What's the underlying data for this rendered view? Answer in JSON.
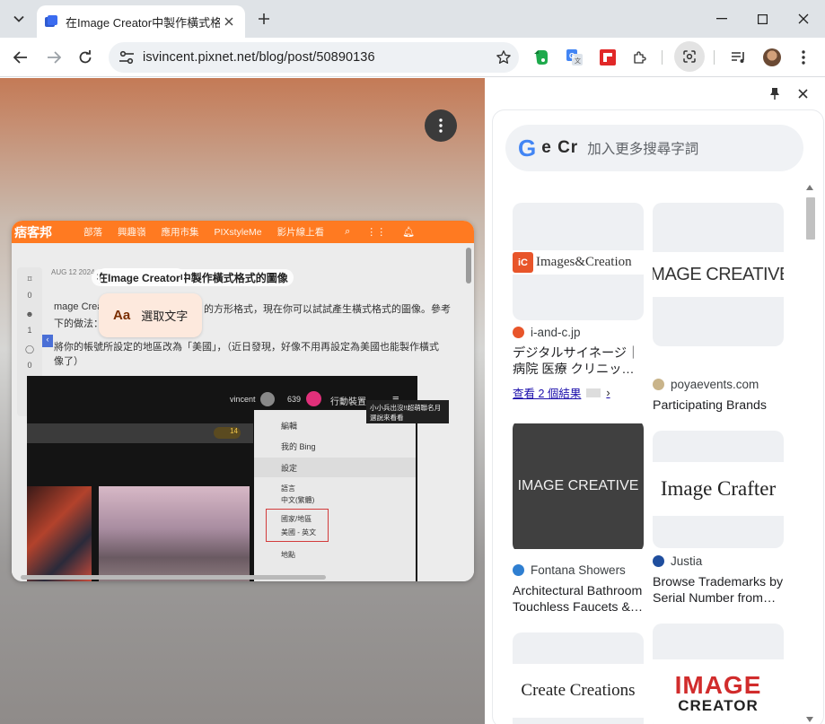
{
  "browser": {
    "tab": {
      "title": "在Image Creator中製作橫式格",
      "favicon": "blue-doc-icon"
    },
    "new_tab_icon": "plus-icon",
    "window_controls": [
      "minimize-icon",
      "maximize-icon",
      "close-icon"
    ],
    "address": {
      "url": "isvincent.pixnet.net/blog/post/50890136"
    },
    "extensions": [
      "evernote-icon",
      "google-translate-icon",
      "flipboard-icon",
      "puzzle-icon",
      "google-lens-icon",
      "media-queue-icon"
    ]
  },
  "lens_view": {
    "select_text_label": "選取文字",
    "select_text_icon": "Aa",
    "screenshot": {
      "logo": "痞客邦",
      "nav": [
        "部落",
        "興趣嶺",
        "應用市集",
        "PIXstyleMe",
        "影片線上看"
      ],
      "date": "AUG 12 2024",
      "title": "在Image Creator中製作橫式格式的圖像",
      "line1": "mage Creat",
      "line1b": "的方形格式，現在你可以試試產生橫式格式的圖像。參考",
      "line2": "下的做法：",
      "line3": "將你的帳號所設定的地區改為「美國」，（近日發現，好像不用再設定為美國也能製作橫式",
      "line4": "像了）",
      "side_counts": [
        "0",
        "1",
        "0",
        "0"
      ],
      "inner": {
        "user": "vincent",
        "count": "639",
        "action": "行動裝置",
        "coins": "14",
        "menu": [
          "編輯",
          "我的 Bing",
          "設定",
          "語言",
          "中文(繁體)",
          "國家/地區",
          "美國 - 英文",
          "地點"
        ],
        "caption": "小小兵出沒!!超萌聯名月 選說來看看"
      }
    }
  },
  "side_panel": {
    "search_placeholder": "加入更多搜尋字詞",
    "search_thumbs": "e Cr",
    "results": [
      {
        "thumb_text": "Images&Creation",
        "thumb_badge": "IC",
        "source": "i-and-c.jp",
        "title": "デジタルサイネージ｜病院 医療 クリニッ…",
        "more": "查看 2 個結果",
        "fav_color": "#e8552a"
      },
      {
        "thumb_text": "IMAGE CREATIVE",
        "source": "poyaevents.com",
        "title": "Participating Brands",
        "fav_color": "#c9b48a"
      },
      {
        "thumb_text": "IMAGE CREATIVE",
        "source": "Fontana Showers",
        "title": "Architectural Bathroom Touchless Faucets &…",
        "fav_color": "#2f7fd1"
      },
      {
        "thumb_text": "Image Crafter",
        "source": "Justia",
        "title": "Browse Trademarks by Serial Number from…",
        "fav_color": "#1f4e9e"
      },
      {
        "thumb_text": "Create Creations"
      },
      {
        "thumb_text": "IMAGE",
        "thumb_text2": "CREATOR"
      }
    ]
  }
}
